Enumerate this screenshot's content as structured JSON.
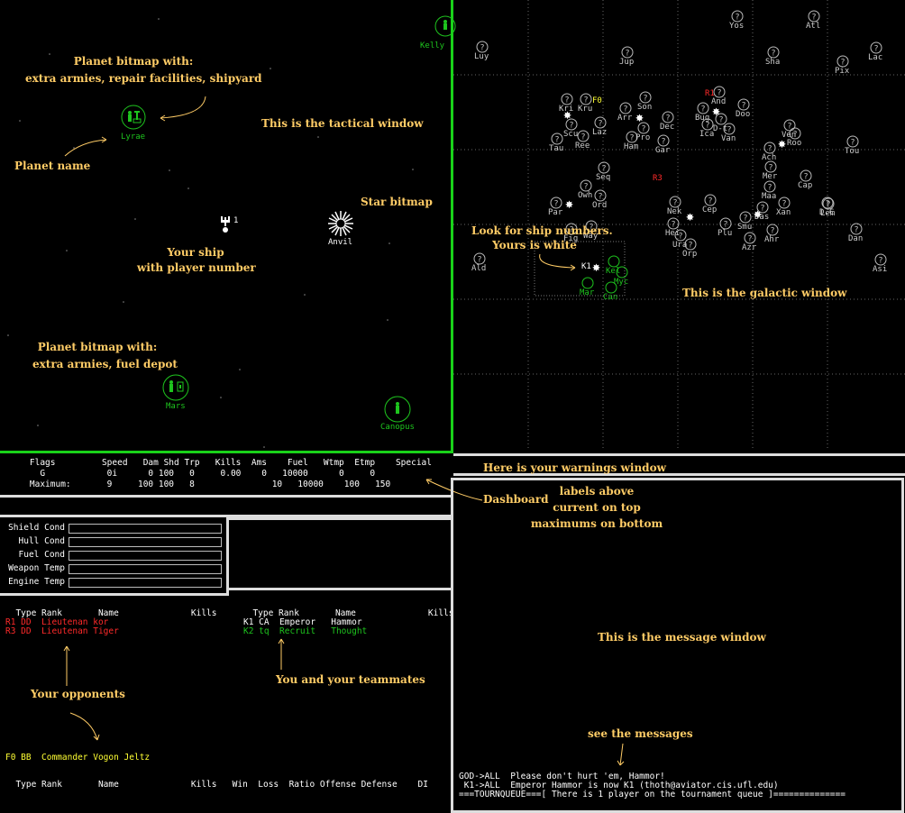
{
  "annotations": {
    "planet_bitmap_1_line1": "Planet bitmap with:",
    "planet_bitmap_1_line2": "extra armies, repair facilities, shipyard",
    "tactical": "This is the tactical window",
    "planet_name": "Planet name",
    "star_bitmap": "Star bitmap",
    "your_ship_line1": "Your ship",
    "your_ship_line2": "with player number",
    "planet_bitmap_2_line1": "Planet bitmap with:",
    "planet_bitmap_2_line2": "extra armies, fuel depot",
    "look_ship_line1": "Look for ship numbers.",
    "look_ship_line2": "Yours is white",
    "galactic": "This is the galactic window",
    "warnings": "Here is your warnings window",
    "dashboard": "Dashboard",
    "labels_line1": "labels above",
    "labels_line2": "current on top",
    "labels_line3": "maximums on bottom",
    "message_window": "This is the message window",
    "see_messages": "see the messages",
    "opponents": "Your opponents",
    "teammates": "You and your teammates"
  },
  "tactical": {
    "planets": [
      {
        "name": "Lyrae",
        "color": "#1ec51e"
      },
      {
        "name": "Mars",
        "color": "#1ec51e"
      },
      {
        "name": "Canopus",
        "color": "#1ec51e"
      },
      {
        "name": "Kelly",
        "color": "#1ec51e"
      }
    ],
    "star_name": "Anvil",
    "ship_number": "1"
  },
  "galactic": {
    "planets": [
      "Yos",
      "Atl",
      "Luy",
      "Lac",
      "Jup",
      "Sha",
      "Pix",
      "Kri",
      "Kru",
      "Son",
      "And",
      "Doo",
      "Arr",
      "Bug",
      "Laz",
      "Dec",
      "Ica",
      "Van",
      "Ven",
      "Tau",
      "Ree",
      "Ham",
      "Gar",
      "Ach",
      "Roo",
      "Tou",
      "Seq",
      "Mer",
      "Cap",
      "Owh",
      "Ord",
      "Maa",
      "D.C",
      "Par",
      "Nek",
      "Cep",
      "Xan",
      "Lem",
      "Fig",
      "Hei",
      "Ura",
      "Plu",
      "Smu",
      "Das",
      "Way",
      "Ahr",
      "Dan",
      "Orp",
      "Azr",
      "Ald",
      "Kel",
      "Myc",
      "Mar",
      "Can",
      "Asi",
      "Scu",
      "Pro",
      "D-t"
    ],
    "ship_labels": {
      "f0": "F0",
      "r1": "R1",
      "r3": "R3",
      "k1": "K1"
    }
  },
  "dashboard": {
    "header": "    Flags         Speed   Dam Shd Trp   Kills  Ams    Fuel   Wtmp  Etmp    Special",
    "current": "      G            0i      0 100   0     0.00    0   10000      0     0",
    "maximum": "    Maximum:       9     100 100   8               10   10000    100   150"
  },
  "conditions": [
    "Shield Cond",
    "Hull Cond",
    "Fuel Cond",
    "Weapon Temp",
    "Engine Temp"
  ],
  "players": {
    "left_header": "  Type Rank       Name              Kills",
    "right_header": "  Type Rank       Name              Kills",
    "opponents": [
      {
        "text": "R1 DD  Lieutenan kor",
        "color": "#ff2a2a"
      },
      {
        "text": "R3 DD  Lieutenan Tiger",
        "color": "#ff2a2a"
      }
    ],
    "team": [
      {
        "text": "K1 CA  Emperor   Hammor",
        "color": "#ffffff"
      },
      {
        "text": "K2 tq  Recruit   Thought",
        "color": "#1ec51e"
      }
    ],
    "other": "F0 BB  Commander Vogon Jeltz",
    "bottom_header": "  Type Rank       Name              Kills   Win  Loss  Ratio Offense Defense    DI"
  },
  "messages": [
    "GOD->ALL  Please don't hurt 'em, Hammor!",
    " K1->ALL  Emperor Hammor is now K1 (thoth@aviator.cis.ufl.edu)",
    "===TOURNQUEUE===[ There is 1 player on the tournament queue ]=============="
  ]
}
